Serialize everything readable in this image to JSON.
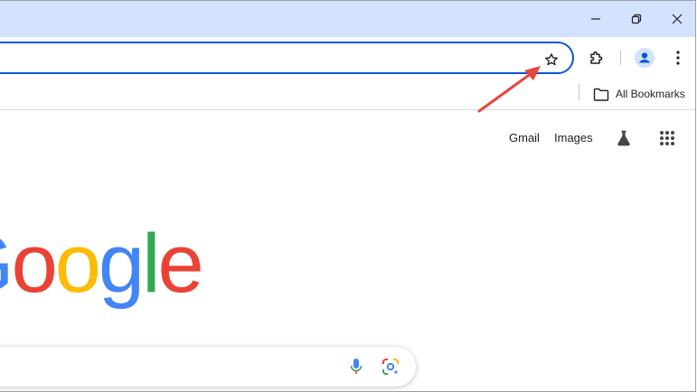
{
  "bookmarks_bar": {
    "all_bookmarks_label": "All Bookmarks"
  },
  "header_links": {
    "gmail": "Gmail",
    "images": "Images"
  },
  "logo": {
    "letters": [
      "o",
      "o",
      "g",
      "l",
      "e"
    ],
    "partial_first_letter": "G"
  },
  "colors": {
    "titlebar": "#d3e3fd",
    "omnibox_border": "#0b57d0",
    "annotation_arrow": "#e8453c",
    "google_blue": "#4285f4",
    "google_red": "#ea4335",
    "google_yellow": "#fbbc05",
    "google_green": "#34a853"
  },
  "icons": {
    "minimize": "minimize-icon",
    "restore": "restore-icon",
    "close": "close-icon",
    "bookmark_star": "star-icon",
    "extensions": "puzzle-icon",
    "profile": "avatar-icon",
    "menu": "kebab-menu-icon",
    "folder": "folder-icon",
    "labs": "flask-icon",
    "apps": "apps-grid-icon",
    "voice": "microphone-icon",
    "lens": "google-lens-icon"
  }
}
